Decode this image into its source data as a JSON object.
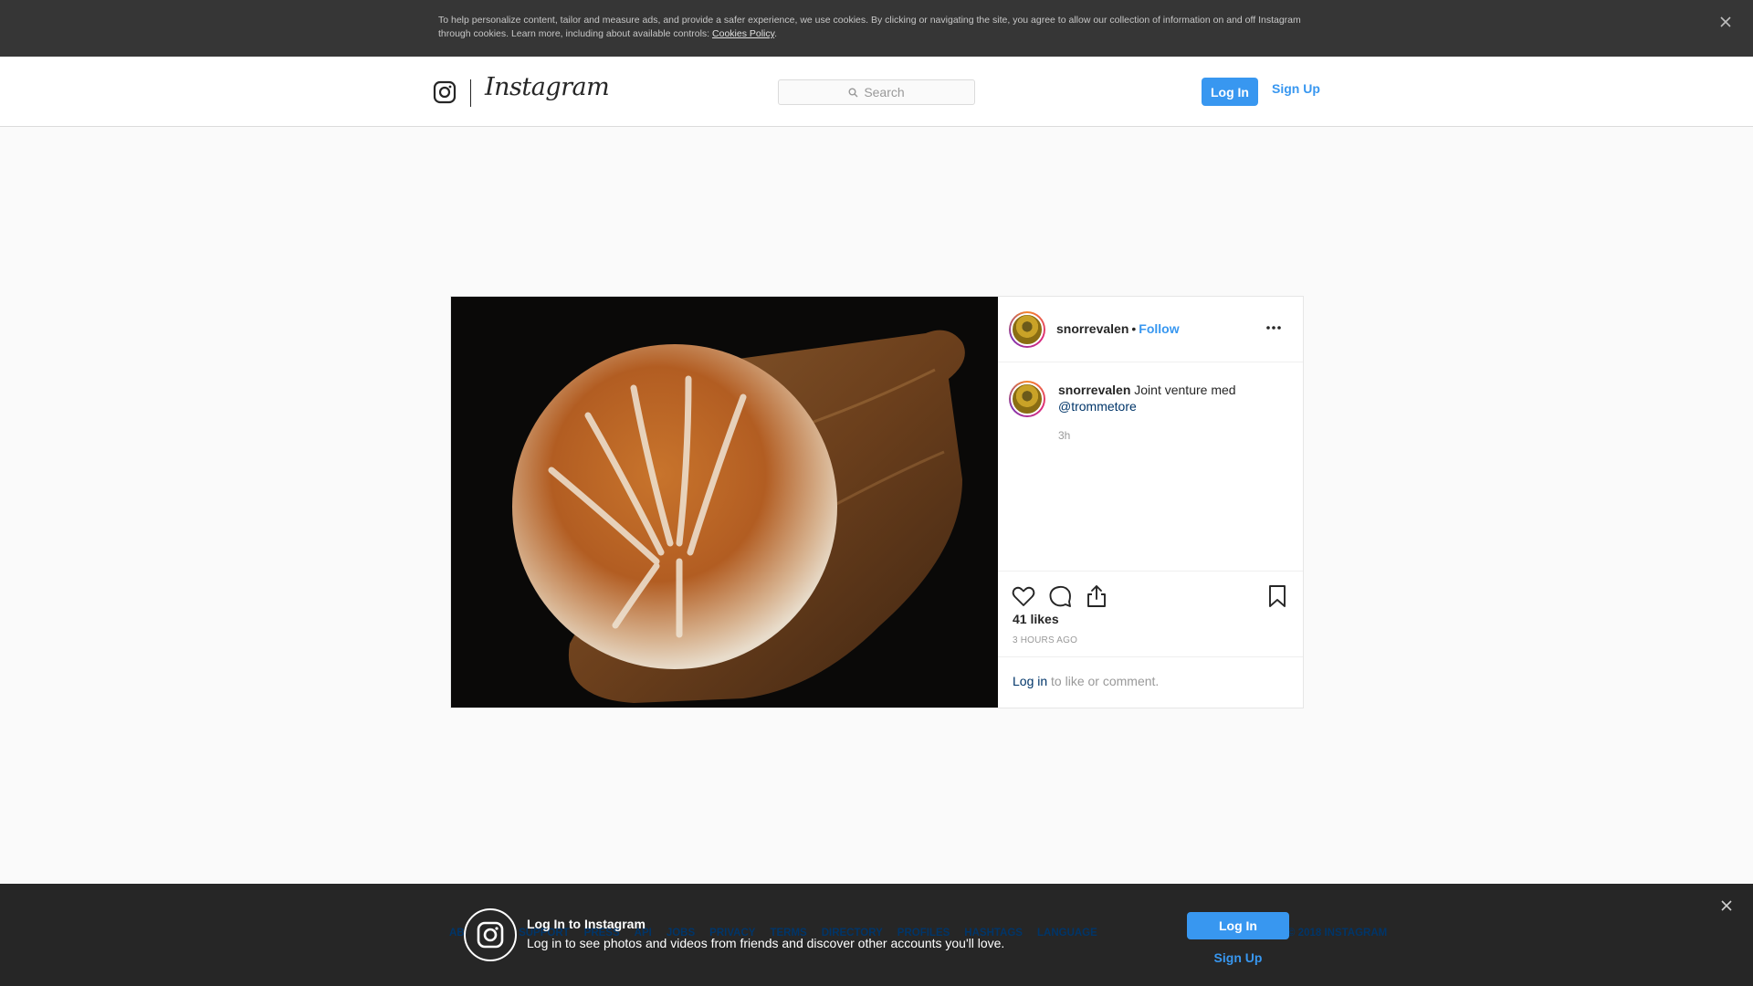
{
  "cookie_banner": {
    "text": "To help personalize content, tailor and measure ads, and provide a safer experience, we use cookies. By clicking or navigating the site, you agree to allow our collection of information on and off Instagram through cookies. Learn more, including about available controls: ",
    "link_label": "Cookies Policy",
    "suffix": ".",
    "close_icon": "close-icon"
  },
  "header": {
    "brand": "Instagram",
    "search_placeholder": "Search",
    "login_label": "Log In",
    "signup_label": "Sign Up"
  },
  "post": {
    "username": "snorrevalen",
    "separator": "•",
    "follow_label": "Follow",
    "caption_user": "snorrevalen",
    "caption_text": " Joint venture med ",
    "caption_mention": "@trommetore",
    "caption_time": "3h",
    "likes": "41 likes",
    "posted_ago": "3 HOURS AGO",
    "comment_link": "Log in",
    "comment_text": " to like or comment.",
    "icons": [
      "heart-icon",
      "comment-icon",
      "share-icon",
      "bookmark-icon",
      "more-icon"
    ]
  },
  "footer": {
    "links": [
      "ABOUT US",
      "SUPPORT",
      "PRESS",
      "API",
      "JOBS",
      "PRIVACY",
      "TERMS",
      "DIRECTORY",
      "PROFILES",
      "HASHTAGS",
      "LANGUAGE"
    ],
    "copyright": "© 2018 INSTAGRAM"
  },
  "login_bar": {
    "title": "Log In to Instagram",
    "subtitle": "Log in to see photos and videos from friends and discover other accounts you'll love.",
    "login_label": "Log In",
    "signup_label": "Sign Up"
  },
  "colors": {
    "accent": "#3897f0",
    "link": "#003569",
    "banner_bg": "#363636",
    "bottom_bg": "#262626"
  }
}
